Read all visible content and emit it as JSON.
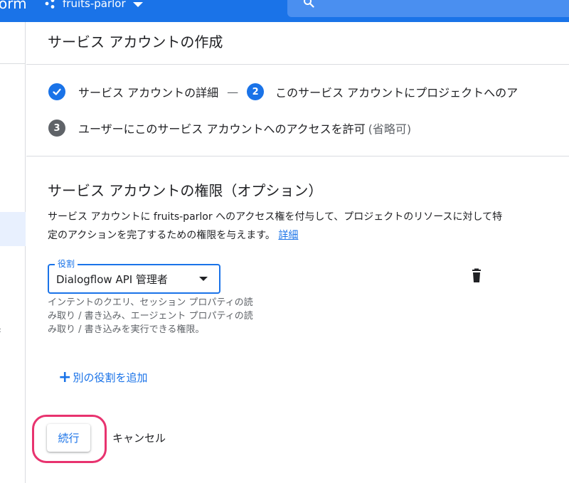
{
  "topbar": {
    "brand_fragment": "orm",
    "project_name": "fruits-parlor",
    "search_icon": "search-icon",
    "color": "#1a73e8"
  },
  "page": {
    "title": "サービス アカウントの作成"
  },
  "steps": [
    {
      "icon": "check-circle-icon",
      "label": "サービス アカウントの詳細",
      "state": "done",
      "color": "#1a73e8"
    },
    {
      "number": "2",
      "label": "このサービス アカウントにプロジェクトへのア",
      "state": "active",
      "color": "#1a73e8"
    },
    {
      "number": "3",
      "label": "ユーザーにこのサービス アカウントへのアクセスを許可",
      "optional": "(省略可)",
      "state": "pending",
      "color": "#5f6368"
    }
  ],
  "step_separator": "—",
  "permissions": {
    "title": "サービス アカウントの権限（オプション）",
    "description": "サービス アカウントに fruits-parlor へのアクセス権を付与して、プロジェクトのリソースに対して特定のアクションを完了するための権限を与えます。",
    "details_link": "詳細",
    "role": {
      "legend": "役割",
      "value": "Dialogflow API 管理者",
      "help": "インテントのクエリ、セッション プロパティの読み取り / 書き込み、エージェント プロパティの読み取り / 書き込みを実行できる権限。"
    },
    "add_role": "別の役割を追加"
  },
  "actions": {
    "continue": "続行",
    "cancel": "キャンセル",
    "highlight_color": "#e8336f"
  }
}
